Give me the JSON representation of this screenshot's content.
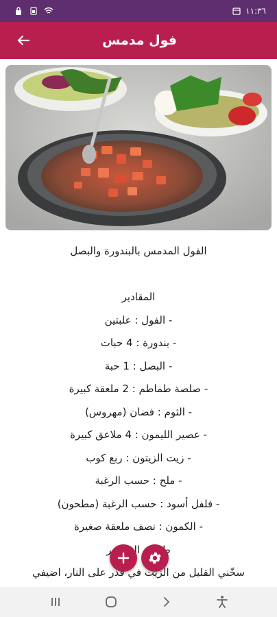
{
  "status_bar": {
    "time": "١١:٣٦",
    "icons": [
      "lock-icon",
      "sim-icon",
      "wifi-icon",
      "calendar-icon",
      "battery-icon"
    ]
  },
  "app_bar": {
    "title": "فول مدمس",
    "back_icon": "arrow-left-icon",
    "color": "#b81f4e"
  },
  "recipe": {
    "image_icon": "ful-medames-dish-photo",
    "lines": [
      "الفول المدمس بالبندورة والبصل",
      "",
      "المقادير",
      "- الفول : علبتين",
      "- بندورة : 4 حبات",
      "- البصل : 1 حبة",
      "- صلصة طماطم : 2 ملعقة كبيرة",
      "- الثوم : فضان (مهروس)",
      "- عصير الليمون : 4 ملاعق كبيرة",
      "- زيت الزيتون : ربع كوب",
      "- ملح : حسب الرغبة",
      "- فلفل أسود : حسب الرغبة (مطحون)",
      "- الكمون : نصف ملعقة صغيرة",
      "طريقة التحضير",
      "سخّني القليل من الزيت في قدر على النار، اضيفي"
    ]
  },
  "fabs": {
    "add_icon": "plus-icon",
    "settings_icon": "gear-icon"
  },
  "nav": {
    "recents_icon": "recents-icon",
    "home_icon": "home-icon",
    "back_icon": "chevron-right-icon",
    "accessibility_icon": "accessibility-icon"
  }
}
